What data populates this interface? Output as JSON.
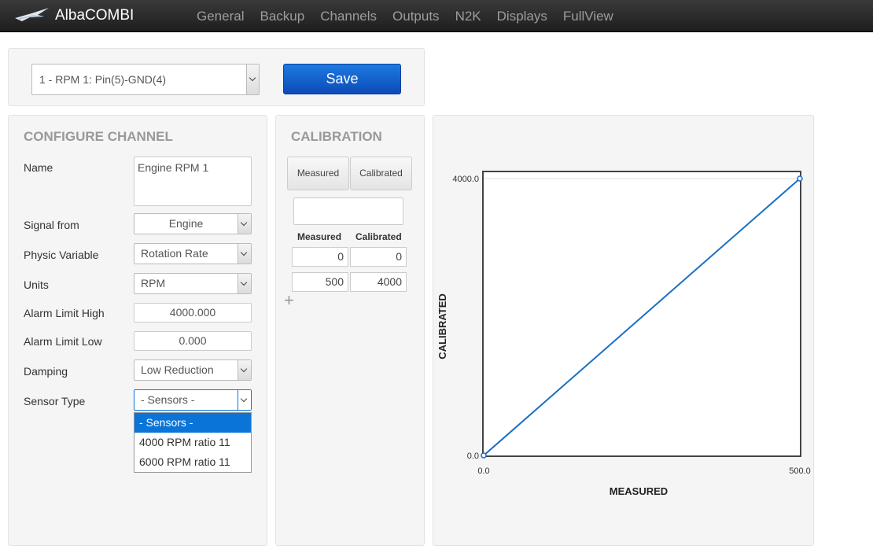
{
  "app": {
    "name": "AlbaCOMBI"
  },
  "nav": [
    {
      "label": "General"
    },
    {
      "label": "Backup"
    },
    {
      "label": "Channels"
    },
    {
      "label": "Outputs"
    },
    {
      "label": "N2K"
    },
    {
      "label": "Displays"
    },
    {
      "label": "FullView"
    }
  ],
  "top": {
    "channel_select": "1 - RPM 1: Pin(5)-GND(4)",
    "save_label": "Save"
  },
  "config": {
    "title": "CONFIGURE CHANNEL",
    "name_label": "Name",
    "name_value": "Engine RPM 1",
    "signal_label": "Signal from",
    "signal_value": "Engine",
    "physic_label": "Physic Variable",
    "physic_value": "Rotation Rate",
    "units_label": "Units",
    "units_value": "RPM",
    "alarm_high_label": "Alarm Limit High",
    "alarm_high_value": "4000.000",
    "alarm_low_label": "Alarm Limit Low",
    "alarm_low_value": "0.000",
    "damping_label": "Damping",
    "damping_value": "Low Reduction",
    "sensor_label": "Sensor Type",
    "sensor_value": "- Sensors -",
    "sensor_options": [
      "- Sensors -",
      "4000 RPM ratio 11",
      "6000 RPM ratio 11"
    ]
  },
  "calibration": {
    "title": "CALIBRATION",
    "btn_measured": "Measured",
    "btn_calibrated": "Calibrated",
    "col_measured": "Measured",
    "col_calibrated": "Calibrated",
    "rows": [
      {
        "measured": "0",
        "calibrated": "0"
      },
      {
        "measured": "500",
        "calibrated": "4000"
      }
    ],
    "add_icon": "+"
  },
  "chart_data": {
    "type": "line",
    "x": [
      0,
      500
    ],
    "y": [
      0,
      4000
    ],
    "xlabel": "MEASURED",
    "ylabel": "CALIBRATED",
    "xlim": [
      0,
      500
    ],
    "ylim": [
      0,
      4000
    ],
    "x_ticks": [
      "0.0",
      "500.0"
    ],
    "y_ticks": [
      "0.0",
      "4000.0"
    ],
    "line_color": "#1a6fc4"
  }
}
